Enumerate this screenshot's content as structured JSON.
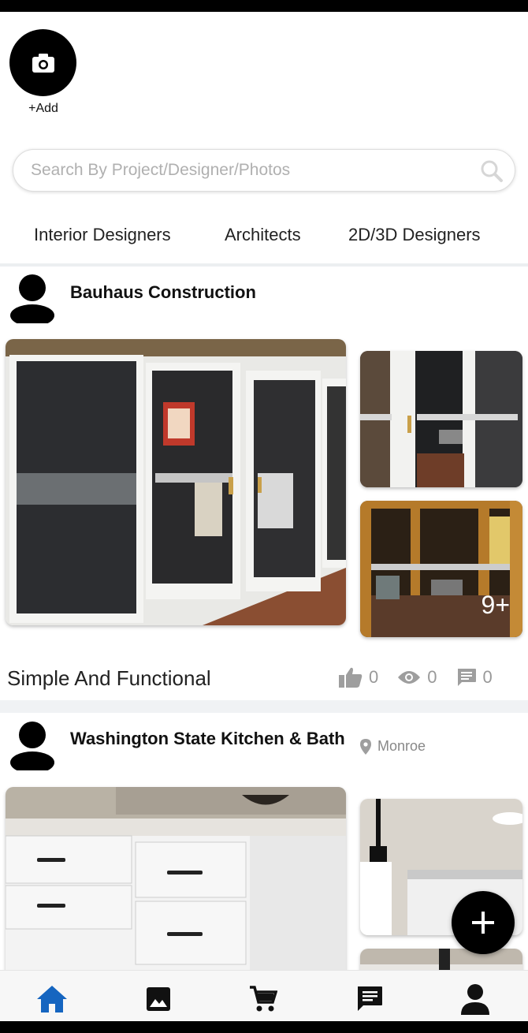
{
  "header": {
    "add_label": "+Add"
  },
  "search": {
    "placeholder": "Search By Project/Designer/Photos",
    "value": ""
  },
  "tabs": [
    {
      "label": "Interior Designers"
    },
    {
      "label": "Architects"
    },
    {
      "label": "2D/3D Designers"
    }
  ],
  "posts": [
    {
      "author": "Bauhaus Construction",
      "location": "",
      "title": "Simple And Functional",
      "more_count": "9+",
      "likes": "0",
      "views": "0",
      "comments": "0"
    },
    {
      "author": "Washington State Kitchen & Bath",
      "location": "Monroe"
    }
  ],
  "nav": [
    {
      "icon": "home-icon",
      "active": true
    },
    {
      "icon": "gallery-icon",
      "active": false
    },
    {
      "icon": "cart-icon",
      "active": false
    },
    {
      "icon": "messages-icon",
      "active": false
    },
    {
      "icon": "profile-icon",
      "active": false
    }
  ],
  "colors": {
    "accent": "#1565c0",
    "fab": "#000000",
    "text": "#222222"
  }
}
